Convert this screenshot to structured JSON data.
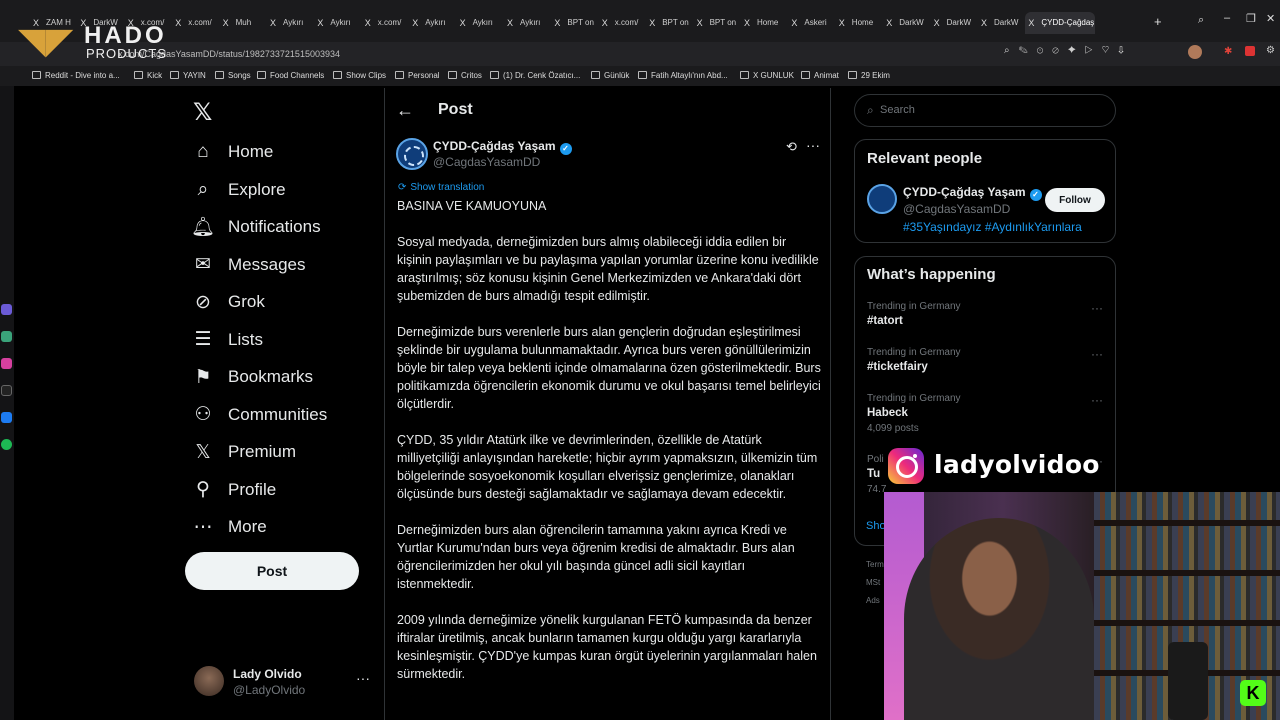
{
  "browser": {
    "tabs": [
      {
        "label": "ZAM H",
        "icon": "X"
      },
      {
        "label": "DarkW",
        "icon": "X"
      },
      {
        "label": "x.com/",
        "icon": "X"
      },
      {
        "label": "x.com/",
        "icon": "X"
      },
      {
        "label": "Muh",
        "icon": "X"
      },
      {
        "label": "Aykırı",
        "icon": "X"
      },
      {
        "label": "Aykırı",
        "icon": "X"
      },
      {
        "label": "x.com/",
        "icon": "X"
      },
      {
        "label": "Aykırı",
        "icon": "X"
      },
      {
        "label": "Aykırı",
        "icon": "X"
      },
      {
        "label": "Aykırı",
        "icon": "X"
      },
      {
        "label": "BPT on",
        "icon": "X"
      },
      {
        "label": "x.com/",
        "icon": "X"
      },
      {
        "label": "BPT on",
        "icon": "X"
      },
      {
        "label": "BPT on",
        "icon": "X"
      },
      {
        "label": "Home",
        "icon": "X"
      },
      {
        "label": "Askeri",
        "icon": "X"
      },
      {
        "label": "Home",
        "icon": "X"
      },
      {
        "label": "DarkW",
        "icon": "X"
      },
      {
        "label": "DarkW",
        "icon": "X"
      },
      {
        "label": "DarkW",
        "icon": "X"
      },
      {
        "label": "ÇYDD-Çağdaş",
        "icon": "X"
      }
    ],
    "url": "x.com/CagdasYasamDD/status/1982733721515003934",
    "bookmarks": [
      "Reddit - Dive into a...",
      "Kick",
      "YAYIN",
      "Songs",
      "Food Channels",
      "Show Clips",
      "Personal",
      "Critos",
      "(1) Dr. Cenk Özatıcı...",
      "Günlük",
      "Fatih Altaylı'nın Abd...",
      "X GUNLUK",
      "Animat",
      "29 Ekim"
    ]
  },
  "overlay": {
    "logo_title": "HADO",
    "logo_sub": "PRODUCTS",
    "instagram_handle": "ladyolvidoo"
  },
  "nav": {
    "items": [
      {
        "label": "Home",
        "icon": "home-icon"
      },
      {
        "label": "Explore",
        "icon": "search-icon"
      },
      {
        "label": "Notifications",
        "icon": "bell-icon"
      },
      {
        "label": "Messages",
        "icon": "envelope-icon"
      },
      {
        "label": "Grok",
        "icon": "grok-icon"
      },
      {
        "label": "Lists",
        "icon": "list-icon"
      },
      {
        "label": "Bookmarks",
        "icon": "bookmark-icon"
      },
      {
        "label": "Communities",
        "icon": "communities-icon"
      },
      {
        "label": "Premium",
        "icon": "x-premium-icon"
      },
      {
        "label": "Profile",
        "icon": "person-icon"
      },
      {
        "label": "More",
        "icon": "more-circle-icon"
      }
    ],
    "post_button": "Post",
    "account": {
      "name": "Lady Olvido",
      "handle": "@LadyOlvido"
    }
  },
  "post": {
    "header": "Post",
    "author_name": "ÇYDD-Çağdaş Yaşam",
    "author_handle": "@CagdasYasamDD",
    "show_translation": "Show translation",
    "paragraphs": [
      "BASINA VE KAMUOYUNA",
      "Sosyal medyada, derneğimizden burs almış olabileceği iddia edilen bir kişinin paylaşımları ve bu paylaşıma yapılan yorumlar üzerine konu ivedilikle araştırılmış; söz konusu kişinin Genel Merkezimizden ve Ankara'daki dört şubemizden de burs almadığı tespit edilmiştir.",
      "Derneğimizde burs verenlerle burs alan gençlerin doğrudan eşleştirilmesi şeklinde bir uygulama bulunmamaktadır. Ayrıca burs veren gönüllülerimizin böyle bir talep veya beklenti içinde olmamalarına özen gösterilmektedir. Burs politikamızda öğrencilerin ekonomik durumu ve okul başarısı temel belirleyici ölçütlerdir.",
      "ÇYDD, 35 yıldır Atatürk ilke ve devrimlerinden, özellikle de Atatürk milliyetçiliği anlayışından hareketle; hiçbir ayrım yapmaksızın, ülkemizin tüm bölgelerinde sosyoekonomik koşulları elverişsiz gençlerimize, olanakları ölçüsünde burs desteği sağlamaktadır ve sağlamaya devam edecektir.",
      "Derneğimizden burs alan öğrencilerin tamamına yakını ayrıca Kredi ve Yurtlar Kurumu'ndan burs veya öğrenim kredisi de almaktadır. Burs alan öğrencilerimizden her okul yılı başında güncel adli sicil kayıtları istenmektedir.",
      "2009 yılında derneğimize yönelik kurgulanan FETÖ kumpasında da benzer iftiralar üretilmiş, ancak bunların tamamen kurgu olduğu yargı kararlarıyla kesinleşmiştir. ÇYDD'ye kumpas kuran örgüt üyelerinin yargılanmaları halen sürmektedir."
    ]
  },
  "sidebar": {
    "search_placeholder": "Search",
    "relevant_title": "Relevant people",
    "relevant": {
      "name": "ÇYDD-Çağdaş Yaşam",
      "handle": "@CagdasYasamDD",
      "bio": "#35Yaşındayız #AydınlıkYarınlara",
      "follow_label": "Follow"
    },
    "happening_title": "What’s happening",
    "trends": [
      {
        "context": "Trending in Germany",
        "name": "#tatort",
        "posts": ""
      },
      {
        "context": "Trending in Germany",
        "name": "#ticketfairy",
        "posts": ""
      },
      {
        "context": "Trending in Germany",
        "name": "Habeck",
        "posts": "4,099 posts"
      },
      {
        "context": "Poli",
        "name": "Tu",
        "posts": "74.7"
      }
    ],
    "show_more": "Sho",
    "footer": [
      "Term",
      "MSt",
      "Ads"
    ]
  }
}
